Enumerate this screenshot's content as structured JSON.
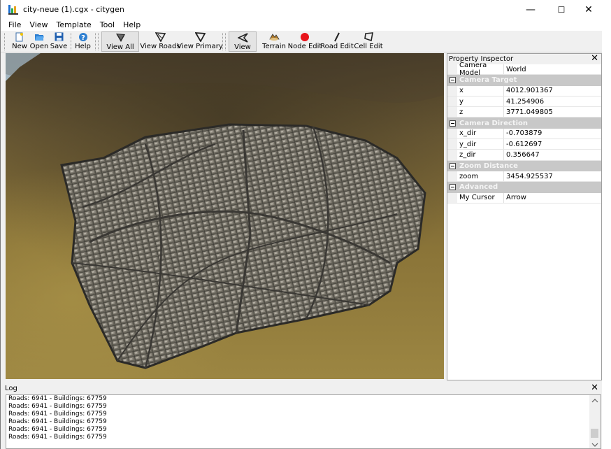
{
  "window": {
    "title": "city-neue (1).cgx - citygen",
    "minimize": "—",
    "maximize": "☐",
    "close": "✕"
  },
  "menu": [
    "File",
    "View",
    "Template",
    "Tool",
    "Help"
  ],
  "toolbar": {
    "new": "New",
    "open": "Open",
    "save": "Save",
    "help": "Help",
    "view_all": "View All",
    "view_roads": "View Roads",
    "view_primary": "View Primary",
    "view": "View",
    "terrain": "Terrain",
    "node_edit": "Node Edit",
    "road_edit": "Road Edit",
    "cell_edit": "Cell Edit",
    "accent_red": "#e8141b"
  },
  "inspector": {
    "title": "Property Inspector",
    "close": "✕",
    "camera_model_label": "Camera Model",
    "camera_model_value": "World",
    "camera_target": {
      "header": "Camera Target",
      "x_label": "x",
      "x": "4012.901367",
      "y_label": "y",
      "y": "41.254906",
      "z_label": "z",
      "z": "3771.049805"
    },
    "camera_direction": {
      "header": "Camera Direction",
      "x_label": "x_dir",
      "x": "-0.703879",
      "y_label": "y_dir",
      "y": "-0.612697",
      "z_label": "z_dir",
      "z": "0.356647"
    },
    "zoom_distance": {
      "header": "Zoom Distance",
      "zoom_label": "zoom",
      "zoom": "3454.925537"
    },
    "advanced": {
      "header": "Advanced",
      "cursor_label": "My Cursor",
      "cursor": "Arrow"
    }
  },
  "log": {
    "title": "Log",
    "close": "✕",
    "lines": [
      "Roads: 6941 - Buildings: 67759",
      "Roads: 6941 - Buildings: 67759",
      "Roads: 6941 - Buildings: 67759",
      "Roads: 6941 - Buildings: 67759",
      "Roads: 6941 - Buildings: 67759",
      "Roads: 6941 - Buildings: 67759"
    ]
  }
}
